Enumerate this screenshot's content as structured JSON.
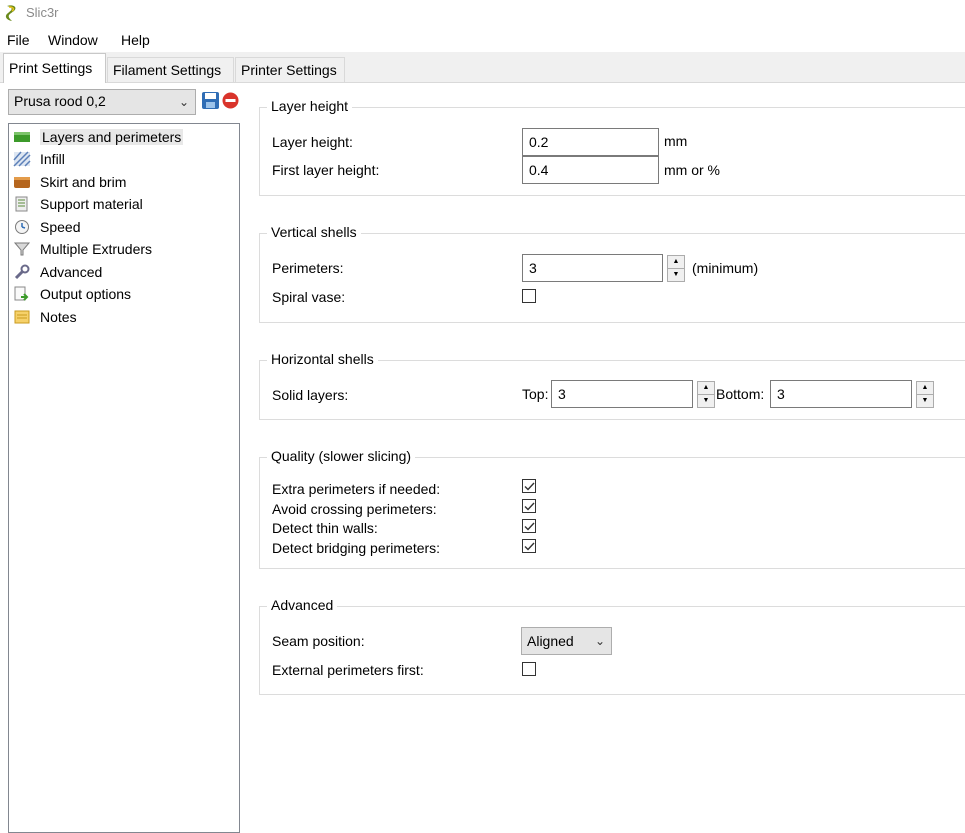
{
  "window": {
    "title": "Slic3r"
  },
  "menu": [
    "File",
    "Window",
    "Help"
  ],
  "tabs": [
    "Print Settings",
    "Filament Settings",
    "Printer Settings"
  ],
  "preset": {
    "selected": "Prusa rood 0,2"
  },
  "sidebar": [
    {
      "label": "Layers and perimeters",
      "icon": "layers-icon"
    },
    {
      "label": "Infill",
      "icon": "infill-icon"
    },
    {
      "label": "Skirt and brim",
      "icon": "skirt-icon"
    },
    {
      "label": "Support material",
      "icon": "support-icon"
    },
    {
      "label": "Speed",
      "icon": "speed-icon"
    },
    {
      "label": "Multiple Extruders",
      "icon": "funnel-icon"
    },
    {
      "label": "Advanced",
      "icon": "wrench-icon"
    },
    {
      "label": "Output options",
      "icon": "output-icon"
    },
    {
      "label": "Notes",
      "icon": "notes-icon"
    }
  ],
  "layer_height": {
    "title": "Layer height",
    "layer_height_label": "Layer height:",
    "layer_height_value": "0.2",
    "layer_height_unit": "mm",
    "first_layer_label": "First layer height:",
    "first_layer_value": "0.4",
    "first_layer_unit": "mm or %"
  },
  "vertical_shells": {
    "title": "Vertical shells",
    "perimeters_label": "Perimeters:",
    "perimeters_value": "3",
    "perimeters_hint": "(minimum)",
    "spiral_label": "Spiral vase:",
    "spiral_checked": false
  },
  "horizontal_shells": {
    "title": "Horizontal shells",
    "solid_label": "Solid layers:",
    "top_label": "Top:",
    "top_value": "3",
    "bottom_label": "Bottom:",
    "bottom_value": "3"
  },
  "quality": {
    "title": "Quality (slower slicing)",
    "items": [
      {
        "label": "Extra perimeters if needed:",
        "checked": true
      },
      {
        "label": "Avoid crossing perimeters:",
        "checked": true
      },
      {
        "label": "Detect thin walls:",
        "checked": true
      },
      {
        "label": "Detect bridging perimeters:",
        "checked": true
      }
    ]
  },
  "advanced": {
    "title": "Advanced",
    "seam_label": "Seam position:",
    "seam_value": "Aligned",
    "external_label": "External perimeters first:",
    "external_checked": false
  },
  "colors": {
    "accent": "#0078d7",
    "layers_green": "#3c9a2a",
    "delete_red": "#d9342b"
  }
}
